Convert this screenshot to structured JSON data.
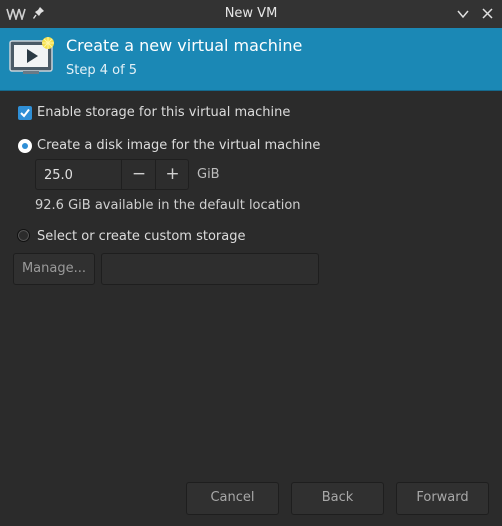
{
  "window": {
    "title": "New VM",
    "icons": [
      "app-icon",
      "pin-icon",
      "chevron-down-icon",
      "close-icon"
    ]
  },
  "header": {
    "title": "Create a new virtual machine",
    "step": "Step 4 of 5",
    "icon": "monitor-new-icon",
    "color": "#1b88b5"
  },
  "storage": {
    "enable_label": "Enable storage for this virtual machine",
    "enable_checked": true,
    "disk_image_label": "Create a disk image for the virtual machine",
    "disk_size": "25.0",
    "disk_unit": "GiB",
    "available_text": "92.6 GiB available in the default location",
    "custom_label": "Select or create custom storage",
    "manage_label": "Manage...",
    "custom_path": ""
  },
  "footer": {
    "cancel": "Cancel",
    "back": "Back",
    "forward": "Forward"
  },
  "colors": {
    "accent": "#2f8fd6",
    "background": "#2b2b2b"
  }
}
